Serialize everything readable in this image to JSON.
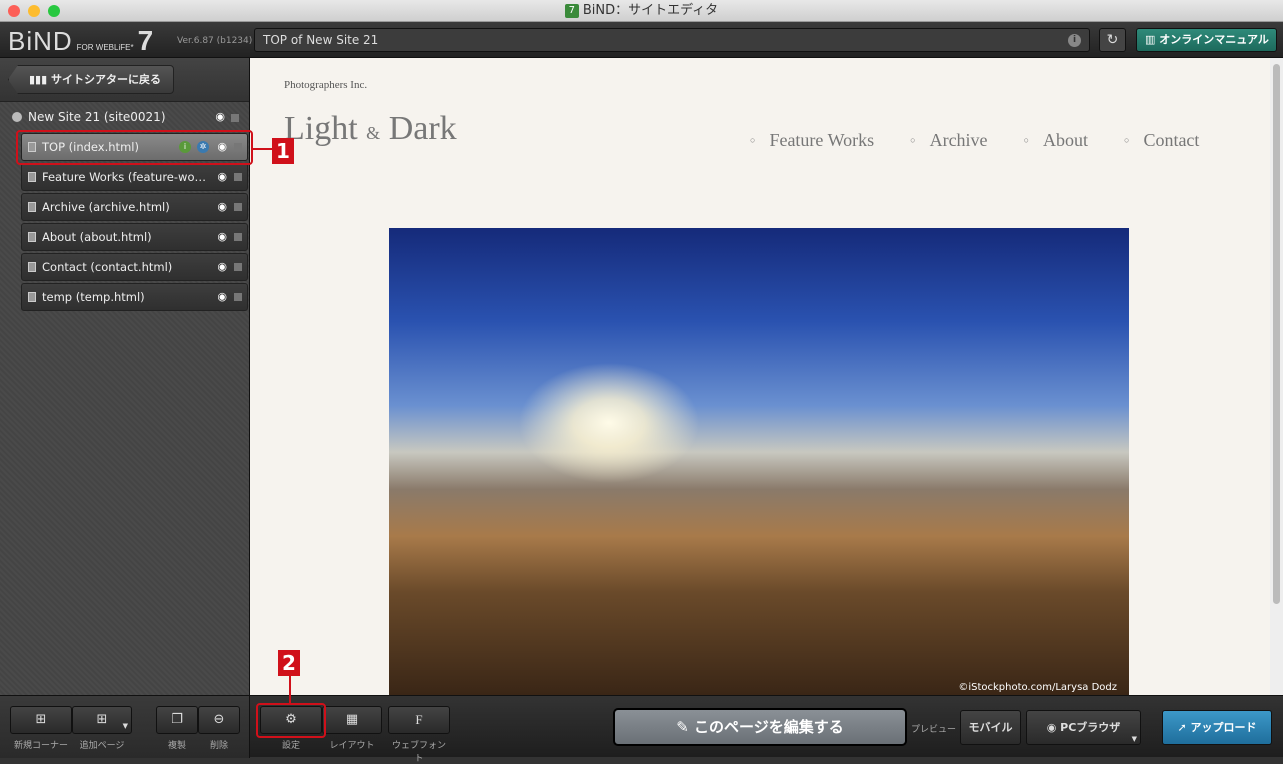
{
  "window": {
    "title": "BiND：サイトエディタ",
    "app_icon": "7"
  },
  "header": {
    "logo": "BiND",
    "logo_sub": "FOR WEBLiFE*",
    "logo_num": "7",
    "version": "Ver.6.87 (b1234)",
    "url": "TOP of New Site 21",
    "manual_label": "オンラインマニュアル"
  },
  "sidebar": {
    "back_label": "サイトシアターに戻る",
    "site": "New Site 21 (site0021)",
    "pages": [
      {
        "label": "TOP (index.html)"
      },
      {
        "label": "Feature Works (feature-works.html)"
      },
      {
        "label": "Archive (archive.html)"
      },
      {
        "label": "About (about.html)"
      },
      {
        "label": "Contact (contact.html)"
      },
      {
        "label": "temp (temp.html)"
      }
    ]
  },
  "preview": {
    "company": "Photographers Inc.",
    "logo_a": "Light",
    "logo_amp": "&",
    "logo_b": "Dark",
    "nav": [
      "Feature Works",
      "Archive",
      "About",
      "Contact"
    ],
    "credit": "©iStockphoto.com/Larysa Dodz"
  },
  "toolbar": {
    "new_corner": "新規コーナー",
    "add_page": "追加ページ",
    "duplicate": "複製",
    "delete": "削除",
    "settings": "設定",
    "layout": "レイアウト",
    "webfont": "ウェブフォント",
    "edit_page": "このページを編集する",
    "preview_label": "プレビュー",
    "mobile": "モバイル",
    "pc_browser": "PCブラウザ",
    "upload": "アップロード"
  },
  "callouts": {
    "one": "1",
    "two": "2"
  },
  "colors": {
    "callout": "#d0101a",
    "upload": "#2a85b8",
    "manual": "#2f8a7a"
  }
}
